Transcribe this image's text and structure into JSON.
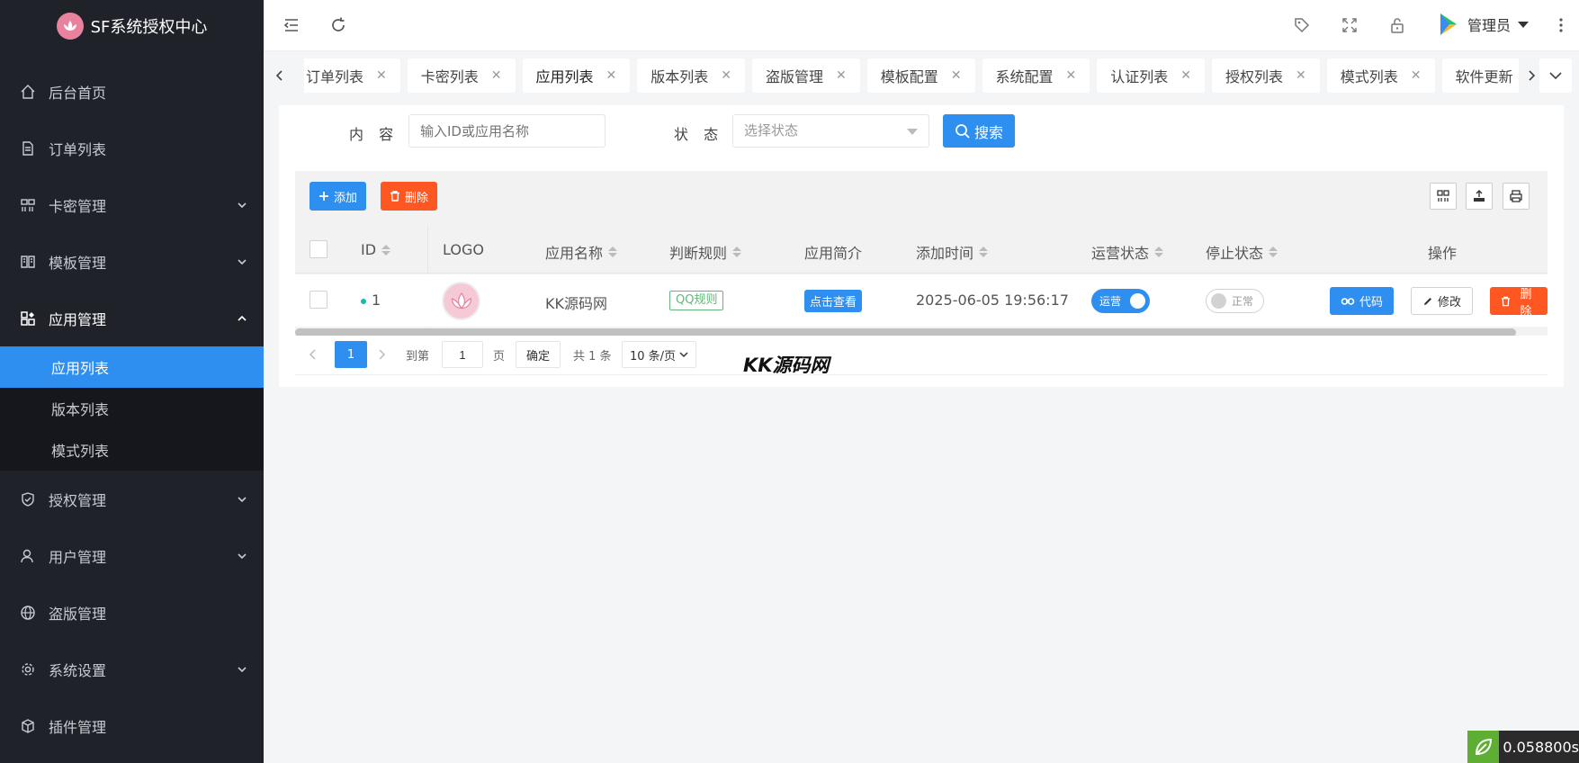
{
  "app": {
    "title": "SF系统授权中心"
  },
  "sidebar": {
    "items": [
      {
        "label": "后台首页",
        "icon": "home-icon"
      },
      {
        "label": "订单列表",
        "icon": "document-icon"
      },
      {
        "label": "卡密管理",
        "icon": "card-icon"
      },
      {
        "label": "模板管理",
        "icon": "template-icon"
      },
      {
        "label": "应用管理",
        "icon": "apps-icon"
      },
      {
        "label": "授权管理",
        "icon": "shield-icon"
      },
      {
        "label": "用户管理",
        "icon": "user-icon"
      },
      {
        "label": "盗版管理",
        "icon": "globe-icon"
      },
      {
        "label": "系统设置",
        "icon": "gear-icon"
      },
      {
        "label": "插件管理",
        "icon": "cube-icon"
      }
    ],
    "submenu": [
      {
        "label": "应用列表"
      },
      {
        "label": "版本列表"
      },
      {
        "label": "模式列表"
      }
    ]
  },
  "header": {
    "user": "管理员"
  },
  "tabs": [
    {
      "label": "订单列表"
    },
    {
      "label": "卡密列表"
    },
    {
      "label": "应用列表"
    },
    {
      "label": "版本列表"
    },
    {
      "label": "盗版管理"
    },
    {
      "label": "模板配置"
    },
    {
      "label": "系统配置"
    },
    {
      "label": "认证列表"
    },
    {
      "label": "授权列表"
    },
    {
      "label": "模式列表"
    },
    {
      "label": "软件更新"
    }
  ],
  "filters": {
    "content_label": "内 容",
    "content_placeholder": "输入ID或应用名称",
    "status_label": "状 态",
    "status_placeholder": "选择状态",
    "search_label": "搜索"
  },
  "toolbar": {
    "add_label": "添加",
    "delete_label": "删除"
  },
  "table": {
    "columns": [
      "ID",
      "LOGO",
      "应用名称",
      "判断规则",
      "应用简介",
      "添加时间",
      "运营状态",
      "停止状态",
      "操作"
    ],
    "rows": [
      {
        "id": "1",
        "name": "KK源码网",
        "rule": "QQ规则",
        "intro": "点击查看",
        "time": "2025-06-05 19:56:17",
        "op_status": "运营",
        "stop_status": "正常",
        "actions": {
          "code": "代码",
          "edit": "修改",
          "delete": "删除"
        }
      }
    ]
  },
  "pager": {
    "current": "1",
    "goto_label": "到第",
    "page_input": "1",
    "page_unit": "页",
    "confirm": "确定",
    "total": "共 1 条",
    "page_size": "10 条/页"
  },
  "watermark": "KK源码网",
  "timer": "0.058800s",
  "colors": {
    "accent": "#2f8ff0",
    "danger": "#ff5722",
    "sidebar": "#20222a",
    "success": "#5fb878"
  }
}
